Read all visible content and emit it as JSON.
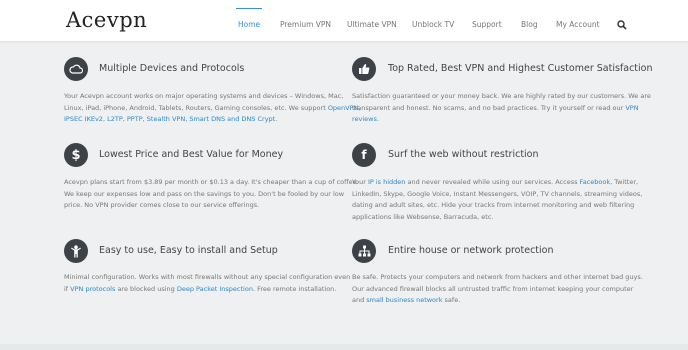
{
  "header": {
    "logo": "Acevpn",
    "nav": [
      {
        "label": "Home",
        "active": true
      },
      {
        "label": "Premium VPN",
        "active": false
      },
      {
        "label": "Ultimate VPN",
        "active": false
      },
      {
        "label": "Unblock TV",
        "active": false
      },
      {
        "label": "Support",
        "active": false
      },
      {
        "label": "Blog",
        "active": false
      },
      {
        "label": "My Account",
        "active": false
      }
    ],
    "search_icon": "search-icon"
  },
  "features": [
    {
      "icon": "cloud-icon",
      "title": "Multiple Devices and Protocols",
      "lines": [
        [
          "Your Acevpn account works on major operating systems and devices – Windows, Mac,"
        ],
        [
          "Linux, iPad, iPhone, Android, Tablets, Routers, Gaming consoles, etc. We support ",
          {
            "link": "OpenVPN,"
          }
        ],
        [
          {
            "link": "IPSEC IKEv2"
          },
          ", ",
          {
            "link": "L2TP"
          },
          ", ",
          {
            "link": "PPTP"
          },
          ", ",
          {
            "link": "Stealth VPN"
          },
          ", ",
          {
            "link": "Smart DNS and DNS Crypt"
          },
          "."
        ]
      ]
    },
    {
      "icon": "thumbs-up-icon",
      "title": "Top Rated, Best VPN and Highest Customer Satisfaction",
      "lines": [
        [
          "Satisfaction guaranteed or your money back. We are highly rated by our customers. We are"
        ],
        [
          "transparent and honest. No scams, and no bad practices. Try it yourself or read our ",
          {
            "link": "VPN"
          }
        ],
        [
          {
            "link": "reviews"
          },
          "."
        ]
      ]
    },
    {
      "icon": "dollar-icon",
      "title": "Lowest Price and Best Value for Money",
      "lines": [
        [
          "Acevpn plans start from $3.89 per month or $0.13 a day. It's cheaper than a cup of coffee."
        ],
        [
          "We keep our expenses low and pass on the savings to you. Don't be fooled by our low"
        ],
        [
          "price. No VPN provider comes close to our service offerings."
        ]
      ]
    },
    {
      "icon": "facebook-icon",
      "title": "Surf the web without restriction",
      "lines": [
        [
          "Your ",
          {
            "link": "IP is hidden"
          },
          " and never revealed while using our services. Access ",
          {
            "link": "Facebook"
          },
          ", Twitter,"
        ],
        [
          "LinkedIn, Skype, Google Voice, Instant Messengers, VOIP, TV channels, streaming videos,"
        ],
        [
          "dating and adult sites, etc. Hide your tracks from internet monitoring and web filtering"
        ],
        [
          "applications like Websense, Barracuda, etc."
        ]
      ]
    },
    {
      "icon": "person-icon",
      "title": "Easy to use, Easy to install and Setup",
      "lines": [
        [
          "Minimal configuration. Works with most firewalls without any special configuration even"
        ],
        [
          "if ",
          {
            "link": "VPN protocols"
          },
          " are blocked using ",
          {
            "link": "Deep Packet Inspection"
          },
          ". Free remote installation."
        ]
      ]
    },
    {
      "icon": "network-icon",
      "title": "Entire house or network protection",
      "lines": [
        [
          "Be safe. Protects your computers and network from hackers and other internet bad guys."
        ],
        [
          "Our advanced firewall blocks all untrusted traffic from internet keeping your computer"
        ],
        [
          "and ",
          {
            "link": "small business network"
          },
          " safe."
        ]
      ]
    }
  ],
  "colors": {
    "link": "#2f87c6",
    "active_nav": "#3a8fd0",
    "icon_bg": "#3d4248"
  }
}
